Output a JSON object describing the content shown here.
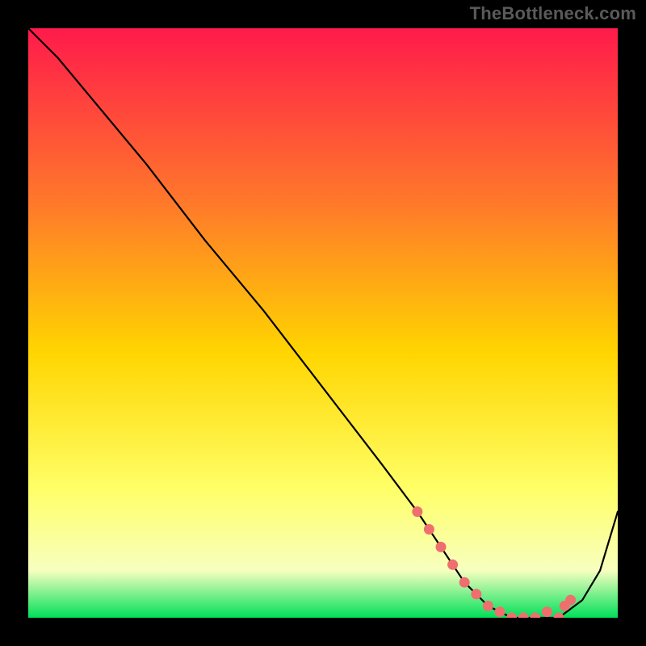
{
  "watermark": "TheBottleneck.com",
  "chart_data": {
    "type": "line",
    "title": "",
    "xlabel": "",
    "ylabel": "",
    "xlim": [
      0,
      100
    ],
    "ylim": [
      0,
      100
    ],
    "grid": false,
    "legend": false,
    "background_gradient": {
      "top": "#ff1a4b",
      "mid_upper": "#ff7a2a",
      "mid": "#ffd500",
      "mid_lower": "#ffff66",
      "band": "#f7ffbf",
      "bottom": "#00e05a"
    },
    "series": [
      {
        "name": "bottleneck-curve",
        "stroke": "#000000",
        "x": [
          0,
          5,
          10,
          20,
          30,
          40,
          50,
          60,
          66,
          70,
          74,
          78,
          82,
          86,
          90,
          94,
          97,
          100
        ],
        "y": [
          100,
          95,
          89,
          77,
          64,
          52,
          39,
          26,
          18,
          12,
          6,
          2,
          0,
          0,
          0,
          3,
          8,
          18
        ]
      }
    ],
    "markers": {
      "name": "highlight-points",
      "fill": "#ef6f6f",
      "stroke": "#ef6f6f",
      "r": 6,
      "x": [
        66,
        68,
        70,
        72,
        74,
        76,
        78,
        80,
        82,
        84,
        86,
        88,
        90,
        91,
        92
      ],
      "y": [
        18,
        15,
        12,
        9,
        6,
        4,
        2,
        1,
        0,
        0,
        0,
        1,
        0,
        2,
        3
      ]
    }
  }
}
